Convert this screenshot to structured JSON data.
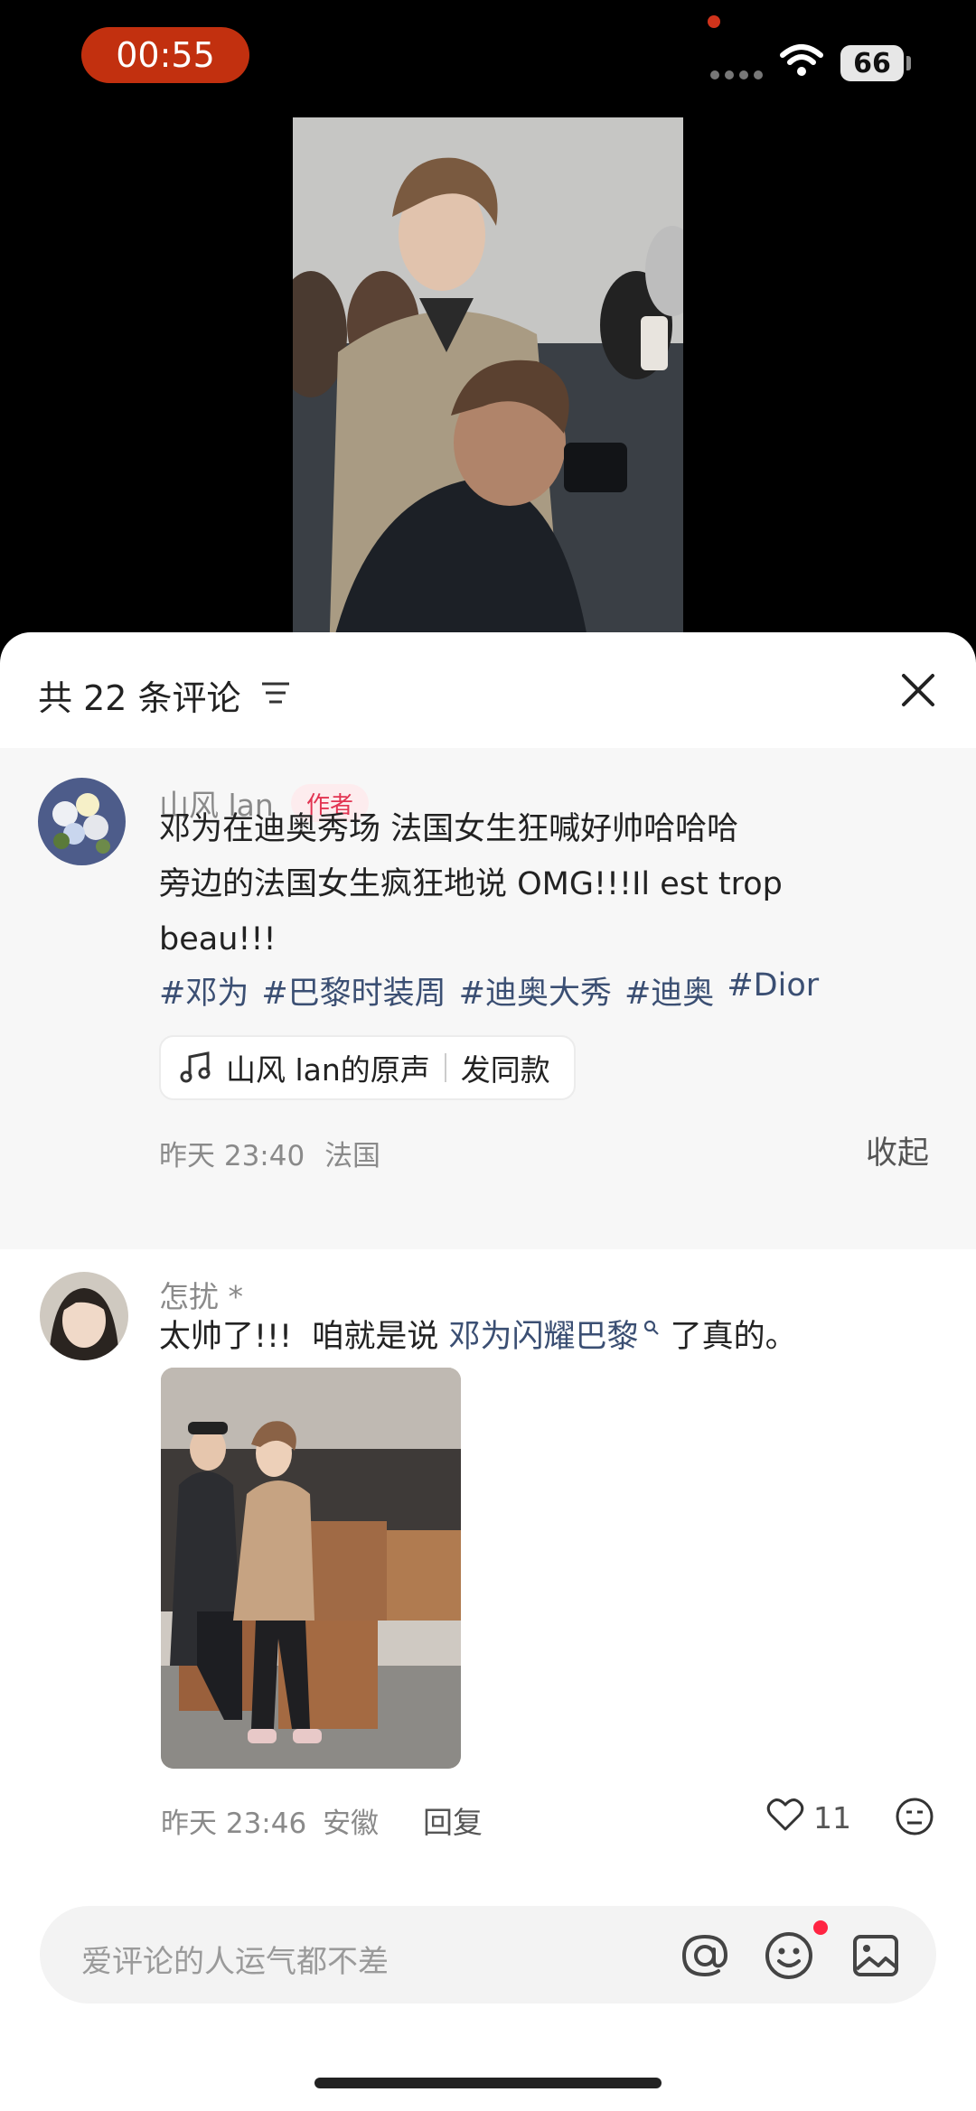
{
  "status_bar": {
    "time": "00:55",
    "battery": "66"
  },
  "comments_sheet": {
    "title": "共 22 条评论",
    "icons": [
      "sort-icon",
      "close-icon"
    ]
  },
  "pinned_comment": {
    "username": "山风 lan",
    "badge": "作者",
    "lines": [
      "邓为在迪奥秀场 法国女生狂喊好帅哈哈哈",
      "旁边的法国女生疯狂地说 OMG!!!Il est trop",
      "beau!!!"
    ],
    "hashtags": [
      "#邓为",
      "#巴黎时装周",
      "#迪奥大秀",
      "#迪奥",
      "#Dior"
    ],
    "sound": {
      "label": "山风 lan的原声",
      "action": "发同款"
    },
    "time": "昨天 23:40",
    "location": "法国",
    "collapse_label": "收起"
  },
  "comment": {
    "username": "怎扰 *",
    "text_before": "太帅了!!!  咱就是说 ",
    "link": "邓为闪耀巴黎",
    "text_after": " 了真的。",
    "time": "昨天 23:46",
    "location": "安徽",
    "reply_label": "回复",
    "likes": "11"
  },
  "input_bar": {
    "placeholder": "爱评论的人运气都不差",
    "icons": [
      "at-icon",
      "emoji-icon",
      "image-icon"
    ]
  },
  "colors": {
    "status_pill": "#c2300f",
    "author_badge": "#e23452",
    "hashtag": "#3b4f73",
    "notification_dot": "#ff2442"
  }
}
